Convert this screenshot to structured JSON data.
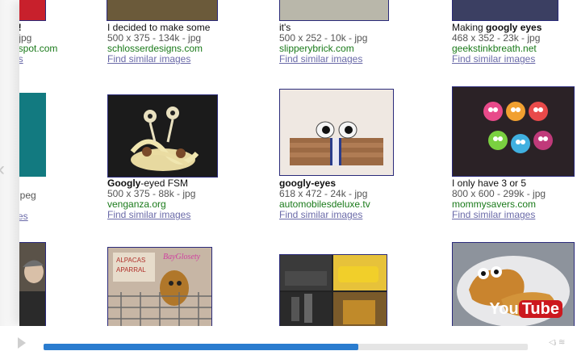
{
  "results": [
    {
      "col": 0,
      "row": 0,
      "title_bold": "s!",
      "title_rest": "",
      "meta": "- jpg",
      "site": "gspot.com",
      "similar": "es"
    },
    {
      "col": 1,
      "row": 0,
      "title_bold": "",
      "title_rest": "I decided to make some",
      "meta": "500 x 375 - 134k - jpg",
      "site": "schlosserdesigns.com",
      "similar": "Find similar images"
    },
    {
      "col": 2,
      "row": 0,
      "title_bold": "",
      "title_rest": "it's",
      "meta": "500 x 252 - 10k - jpg",
      "site": "slipperybrick.com",
      "similar": "Find similar images"
    },
    {
      "col": 3,
      "row": 0,
      "title_pre": "Making ",
      "title_bold": "googly eyes",
      "title_rest": "",
      "meta": "468 x 352 - 23k - jpg",
      "site": "geekstinkbreath.net",
      "similar": "Find similar images"
    },
    {
      "col": 0,
      "row": 1,
      "title_bold": "",
      "title_rest": "",
      "meta": "jpeg",
      "site": "",
      "similar": "es"
    },
    {
      "col": 1,
      "row": 1,
      "title_bold": "Googly",
      "title_rest": "-eyed FSM",
      "meta": "500 x 375 - 88k - jpg",
      "site": "venganza.org",
      "similar": "Find similar images"
    },
    {
      "col": 2,
      "row": 1,
      "title_bold": "googly-eyes",
      "title_rest": "",
      "meta": "618 x 472 - 24k - jpg",
      "site": "automobilesdeluxe.tv",
      "similar": "Find similar images"
    },
    {
      "col": 3,
      "row": 1,
      "title_bold": "",
      "title_rest": "I only have 3 or 5",
      "meta": "800 x 600 - 299k - jpg",
      "site": "mommysavers.com",
      "similar": "Find similar images"
    }
  ],
  "thumb_text": {
    "alpaca_sign": "ALPACAS",
    "alpaca_sign2": "APARRAL",
    "alpaca_script": "BayGlosety"
  },
  "logo": {
    "you": "You",
    "tube": "Tube"
  },
  "player": {
    "progress_fraction": 0.65,
    "accent": "#2a7ccf"
  }
}
